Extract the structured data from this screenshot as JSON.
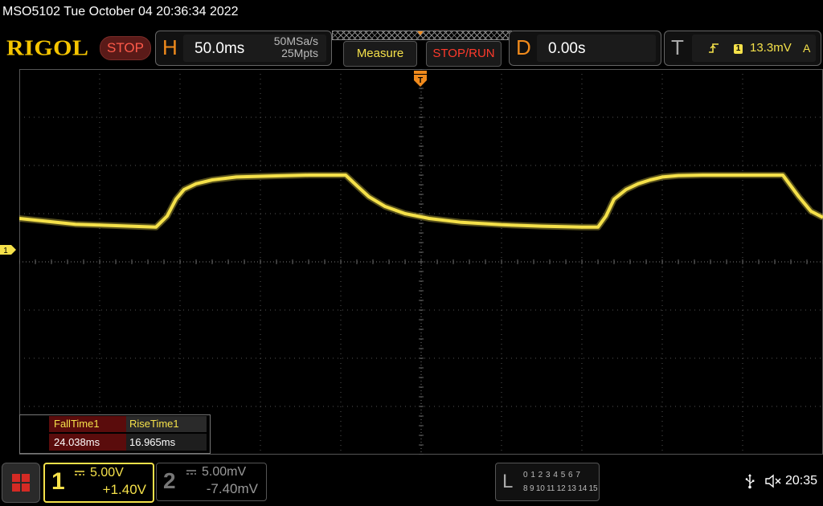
{
  "status_line": "MSO5102  Tue October 04 20:36:34 2022",
  "brand": "RIGOL",
  "run_state": "STOP",
  "horizontal": {
    "letter": "H",
    "timebase": "50.0ms",
    "sample_rate": "50MSa/s",
    "memory_depth": "25Mpts"
  },
  "buttons": {
    "measure": "Measure",
    "stop_run": "STOP/RUN"
  },
  "delay": {
    "letter": "D",
    "value": "0.00s"
  },
  "trigger": {
    "letter": "T",
    "edge_icon": "rising-edge-icon",
    "channel": "1",
    "level": "13.3mV",
    "coupling": "A"
  },
  "screen_markers": {
    "ch1": "1",
    "trigger": "T"
  },
  "measurements": [
    {
      "name": "FallTime1",
      "value": "24.038ms"
    },
    {
      "name": "RiseTime1",
      "value": "16.965ms"
    }
  ],
  "channel1": {
    "number": "1",
    "scale": "5.00V",
    "offset": "+1.40V",
    "color": "#f5e14a"
  },
  "channel2": {
    "number": "2",
    "scale": "5.00mV",
    "offset": "-7.40mV"
  },
  "logic": {
    "letter": "L",
    "row1": "0 1 2 3  4 5 6 7",
    "row2": "8 9 10 11 12 13 14 15"
  },
  "clock": "20:35",
  "colors": {
    "accent_orange": "#f08a1c",
    "trace_yellow": "#f5e14a",
    "stop_red": "#ff3a2c"
  },
  "chart_data": {
    "type": "line",
    "title": "",
    "xlabel": "",
    "ylabel": "",
    "grid": true,
    "x_divisions": 10,
    "y_divisions": 8,
    "xlim": [
      0,
      10
    ],
    "ylim": [
      -4,
      4
    ],
    "series": [
      {
        "x": [
          0,
          0.7,
          1.7,
          1.84,
          1.95,
          2.05,
          2.2,
          2.4,
          2.7,
          3.1,
          3.6,
          4.06,
          4.2,
          4.35,
          4.55,
          4.8,
          5.1,
          5.5,
          6.0,
          6.5,
          7.0,
          7.2,
          7.3,
          7.4,
          7.55,
          7.7,
          7.85,
          8.0,
          8.2,
          8.5,
          9.0,
          9.5,
          9.7,
          9.85,
          10.0
        ],
        "y": [
          0.9,
          0.78,
          0.72,
          0.95,
          1.3,
          1.5,
          1.62,
          1.7,
          1.76,
          1.78,
          1.8,
          1.8,
          1.58,
          1.35,
          1.15,
          1.0,
          0.9,
          0.82,
          0.77,
          0.74,
          0.72,
          0.72,
          0.95,
          1.3,
          1.5,
          1.62,
          1.7,
          1.76,
          1.79,
          1.8,
          1.8,
          1.8,
          1.35,
          1.05,
          0.92
        ]
      }
    ]
  }
}
